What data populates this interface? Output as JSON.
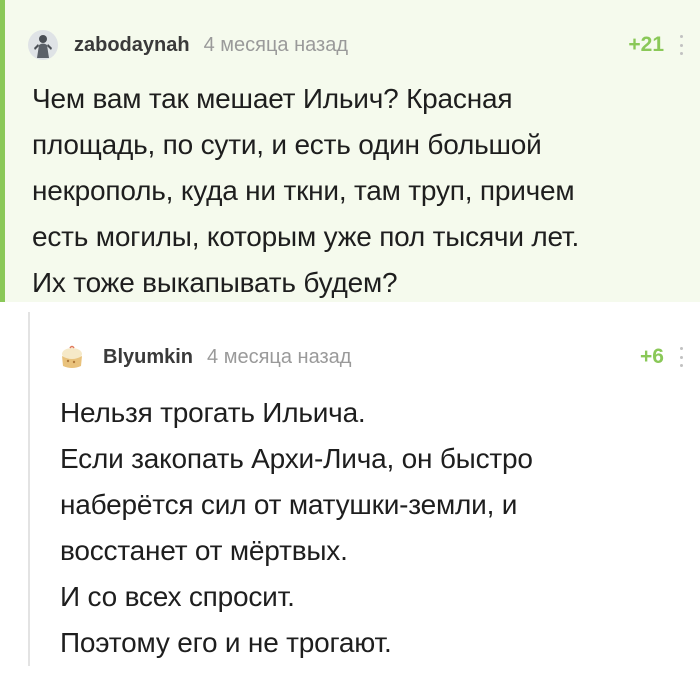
{
  "comments": [
    {
      "username": "zabodaynah",
      "timestamp": "4 месяца назад",
      "rating": "+21",
      "avatar_icon": "user-avatar-figure-icon",
      "highlighted": true,
      "text": "Чем вам так мешает Ильич? Красная\nплощадь, по сути, и есть один большой\nнекрополь, куда ни ткни, там труп, причем\nесть могилы, которым уже пол тысячи лет.\nИх тоже выкапывать будем?"
    },
    {
      "username": "Blyumkin",
      "timestamp": "4 месяца назад",
      "rating": "+6",
      "avatar_icon": "user-avatar-cake-icon",
      "lines": [
        "Нельзя трогать Ильича.",
        "Если закопать Архи-Лича, он быстро",
        "наберётся сил от матушки-земли, и",
        "восстанет от мёртвых.",
        "И со всех спросит.",
        "Поэтому его и не трогают."
      ]
    }
  ],
  "colors": {
    "accent_green": "#8ac858",
    "highlight_bg": "#f5faed",
    "timestamp_gray": "#9a9a9a",
    "thread_line": "#e3e3e3"
  },
  "icons": {
    "more": "vertical-ellipsis-icon"
  }
}
